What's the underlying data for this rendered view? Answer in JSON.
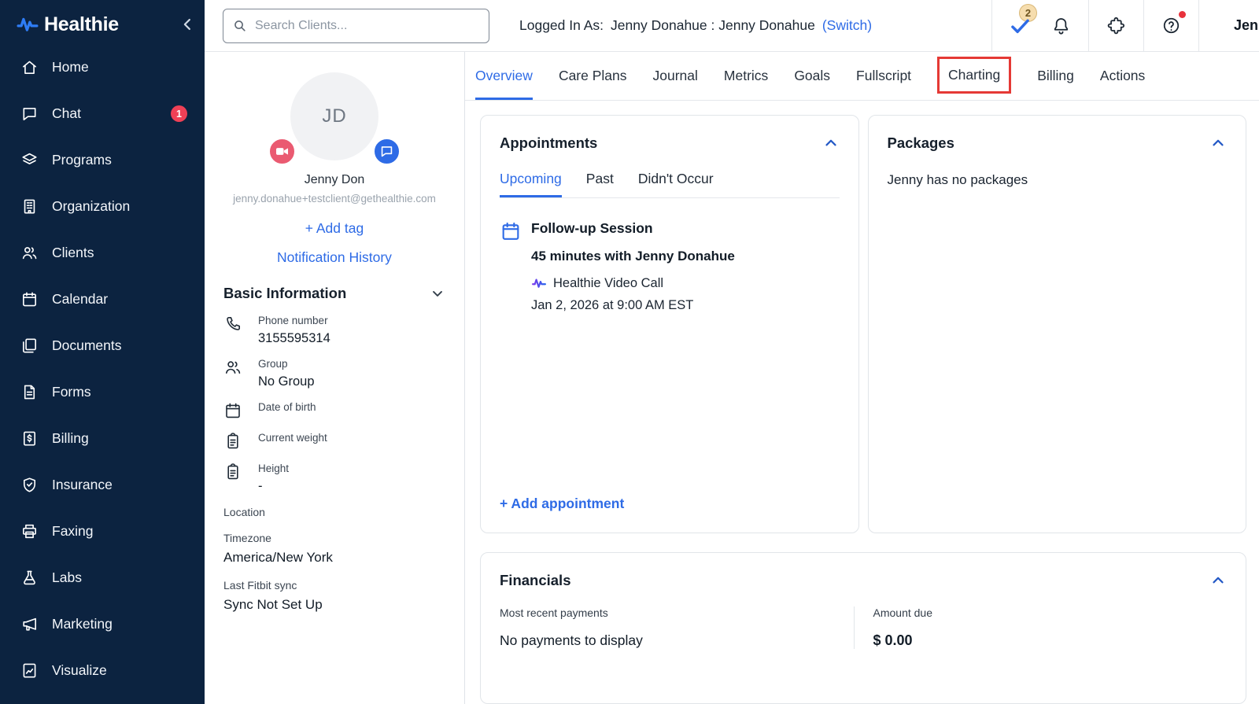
{
  "colors": {
    "accent": "#2e6be6",
    "sidebar_bg": "#0c2340",
    "badge_red": "#ef4056",
    "highlight_red": "#e53935",
    "video_btn_pink": "#ea5a71"
  },
  "brand": {
    "name": "Healthie"
  },
  "sidebar": {
    "items": [
      {
        "label": "Home"
      },
      {
        "label": "Chat",
        "badge": "1"
      },
      {
        "label": "Programs"
      },
      {
        "label": "Organization"
      },
      {
        "label": "Clients"
      },
      {
        "label": "Calendar"
      },
      {
        "label": "Documents"
      },
      {
        "label": "Forms"
      },
      {
        "label": "Billing"
      },
      {
        "label": "Insurance"
      },
      {
        "label": "Faxing"
      },
      {
        "label": "Labs"
      },
      {
        "label": "Marketing"
      },
      {
        "label": "Visualize"
      }
    ]
  },
  "topbar": {
    "search_placeholder": "Search Clients...",
    "logged_in_label": "Logged In As:",
    "logged_in_user": "Jenny Donahue : Jenny Donahue",
    "switch_link": "(Switch)",
    "tasks_badge": "2",
    "user_name_truncated": "Jenn"
  },
  "client": {
    "initials": "JD",
    "name": "Jenny Don",
    "email": "jenny.donahue+testclient@gethealthie.com",
    "add_tag_label": "+ Add tag",
    "notification_history_label": "Notification History",
    "section_title": "Basic Information",
    "fields": [
      {
        "label": "Phone number",
        "value": "3155595314"
      },
      {
        "label": "Group",
        "value": "No Group"
      },
      {
        "label": "Date of birth",
        "value": ""
      },
      {
        "label": "Current weight",
        "value": ""
      },
      {
        "label": "Height",
        "value": "-"
      }
    ],
    "location_label": "Location",
    "timezone_label": "Timezone",
    "timezone_value": "America/New York",
    "fitbit_label": "Last Fitbit sync",
    "fitbit_value": "Sync Not Set Up"
  },
  "tabs": {
    "items": [
      "Overview",
      "Care Plans",
      "Journal",
      "Metrics",
      "Goals",
      "Fullscript",
      "Charting",
      "Billing",
      "Actions"
    ],
    "active": "Overview",
    "highlighted": "Charting"
  },
  "appointments": {
    "title": "Appointments",
    "tabs": [
      "Upcoming",
      "Past",
      "Didn't Occur"
    ],
    "active_tab": "Upcoming",
    "items": [
      {
        "title": "Follow-up Session",
        "duration": "45 minutes with Jenny Donahue",
        "contact_type": "Healthie Video Call",
        "datetime": "Jan 2, 2026 at 9:00 AM EST"
      }
    ],
    "add_label": "+ Add appointment"
  },
  "packages": {
    "title": "Packages",
    "empty_message": "Jenny has no packages"
  },
  "financials": {
    "title": "Financials",
    "recent_payments_label": "Most recent payments",
    "recent_payments_value": "No payments to display",
    "amount_due_label": "Amount due",
    "amount_due_value": "$ 0.00"
  }
}
